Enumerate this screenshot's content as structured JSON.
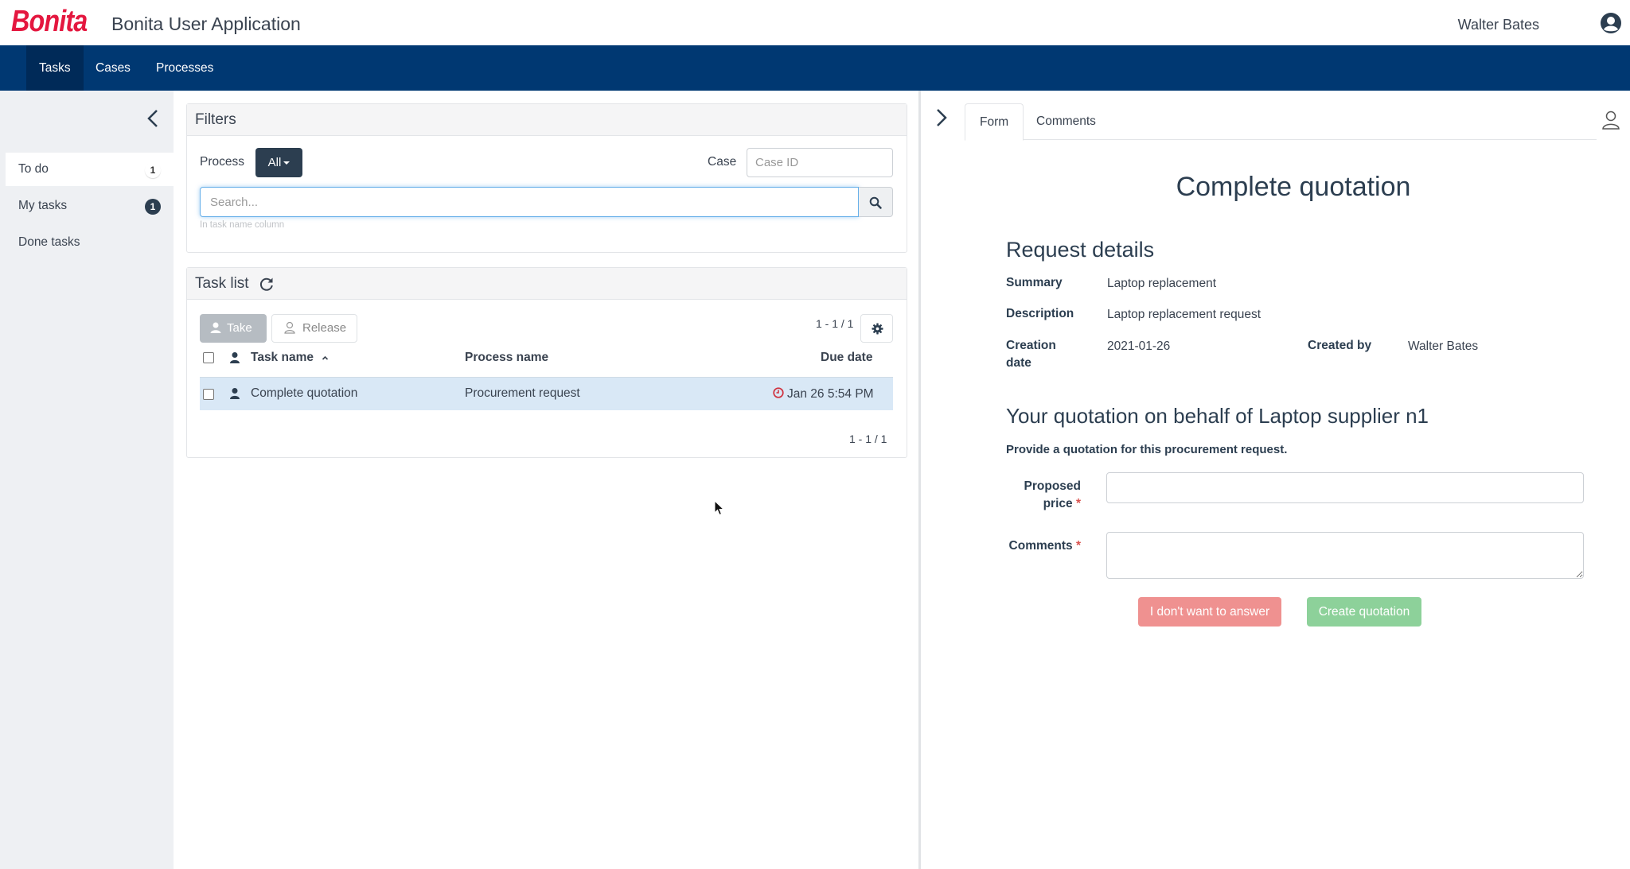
{
  "header": {
    "logo": "Bonita",
    "app_title": "Bonita User Application",
    "user_name": "Walter Bates",
    "user_icon": "user-circle-icon"
  },
  "nav": {
    "items": [
      {
        "label": "Tasks",
        "active": true
      },
      {
        "label": "Cases",
        "active": false
      },
      {
        "label": "Processes",
        "active": false
      }
    ]
  },
  "sidebar": {
    "collapse_icon": "chevron-left-icon",
    "items": [
      {
        "label": "To do",
        "badge": "1",
        "active": true
      },
      {
        "label": "My tasks",
        "badge": "1",
        "active": false
      },
      {
        "label": "Done tasks",
        "badge": null,
        "active": false
      }
    ]
  },
  "filters": {
    "title": "Filters",
    "process_label": "Process",
    "process_value": "All",
    "case_label": "Case",
    "case_placeholder": "Case ID",
    "search_placeholder": "Search...",
    "search_help": "In task name column"
  },
  "task_list": {
    "title": "Task list",
    "take_label": "Take",
    "release_label": "Release",
    "pager_top": "1 - 1 / 1",
    "pager_bottom": "1 - 1 / 1",
    "columns": {
      "task_name": "Task name",
      "process_name": "Process name",
      "due_date": "Due date"
    },
    "rows": [
      {
        "task_name": "Complete quotation",
        "process_name": "Procurement request",
        "due_date": "Jan 26 5:54 PM",
        "overdue": true
      }
    ]
  },
  "details": {
    "tabs": [
      {
        "label": "Form",
        "active": true
      },
      {
        "label": "Comments",
        "active": false
      }
    ],
    "form_title": "Complete quotation",
    "request_heading": "Request details",
    "fields": {
      "summary_label": "Summary",
      "summary_value": "Laptop replacement",
      "description_label": "Description",
      "description_value": "Laptop replacement request",
      "creation_label_1": "Creation",
      "creation_label_2": "date",
      "creation_value": "2021-01-26",
      "created_by_label": "Created by",
      "created_by_value": "Walter Bates"
    },
    "quotation_heading": "Your quotation on behalf of Laptop supplier n1",
    "intro": "Provide a quotation for this procurement request.",
    "price_label_1": "Proposed",
    "price_label_2": "price",
    "price_value": "",
    "comments_label": "Comments",
    "comments_value": "",
    "required_mark": "*",
    "decline_label": "I don't want to answer",
    "create_label": "Create quotation"
  },
  "colors": {
    "brand": "#e4173f",
    "navbar": "#003872",
    "danger_button": "#ef9190",
    "success_button": "#8dd19a",
    "selected_row": "#d9e8f6"
  }
}
